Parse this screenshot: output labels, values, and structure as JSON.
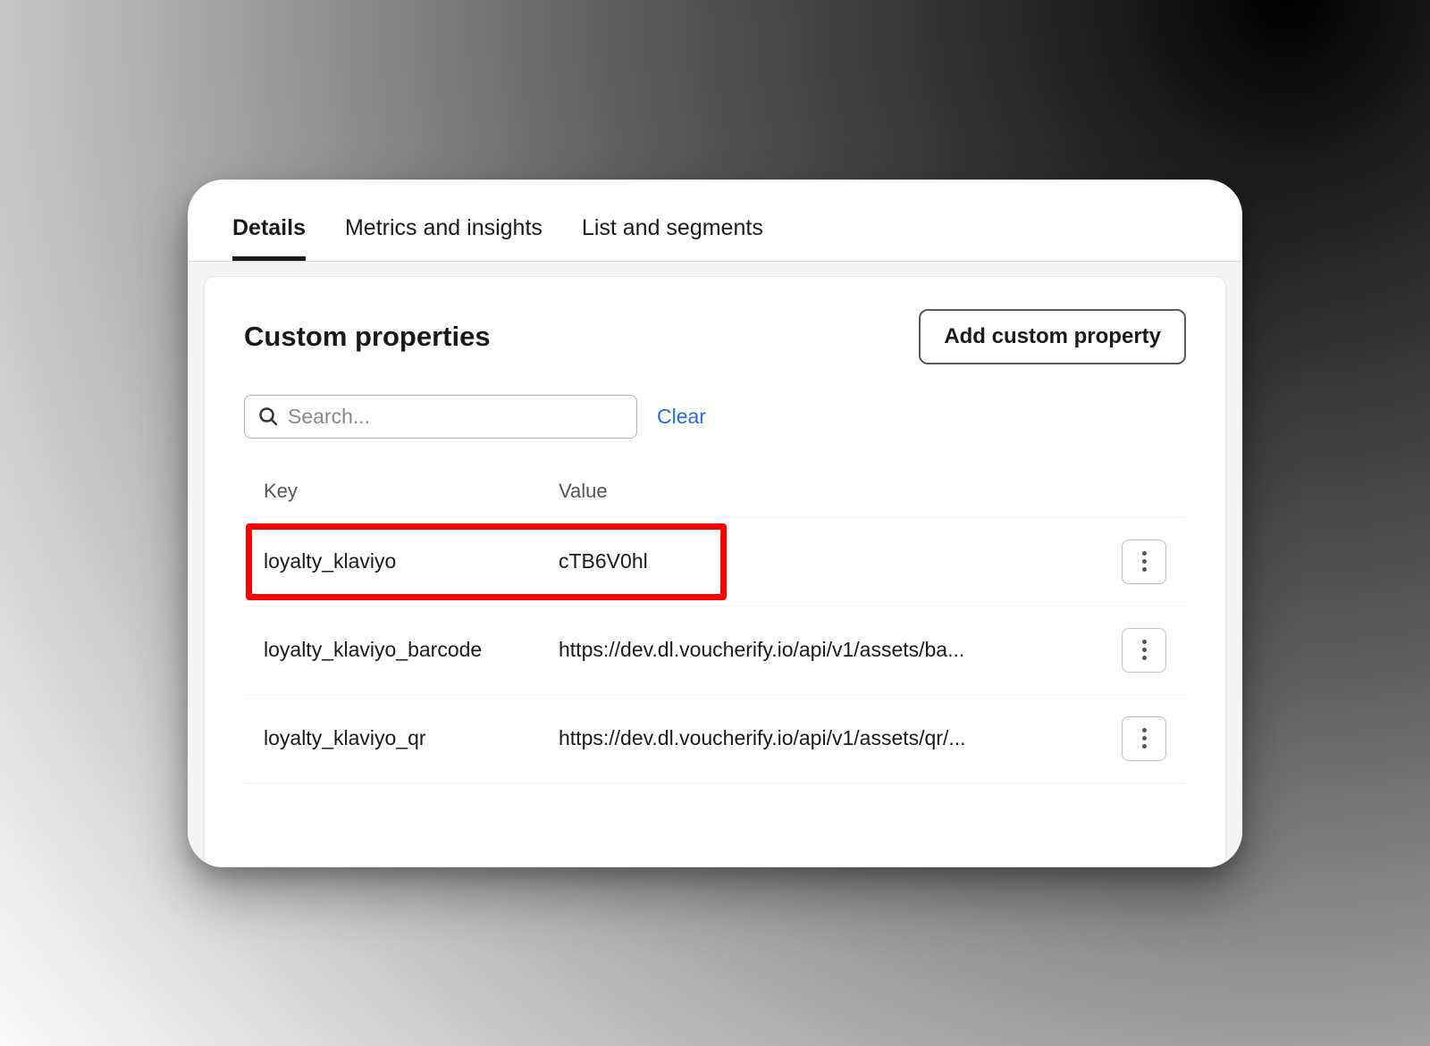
{
  "tabs": [
    {
      "label": "Details",
      "active": true
    },
    {
      "label": "Metrics and insights",
      "active": false
    },
    {
      "label": "List and segments",
      "active": false
    }
  ],
  "panel": {
    "title": "Custom properties",
    "add_button": "Add custom property",
    "search_placeholder": "Search...",
    "clear_label": "Clear",
    "columns": {
      "key": "Key",
      "value": "Value"
    },
    "rows": [
      {
        "key": "loyalty_klaviyo",
        "value": "cTB6V0hl",
        "highlighted": true
      },
      {
        "key": "loyalty_klaviyo_barcode",
        "value": "https://dev.dl.voucherify.io/api/v1/assets/ba...",
        "highlighted": false
      },
      {
        "key": "loyalty_klaviyo_qr",
        "value": "https://dev.dl.voucherify.io/api/v1/assets/qr/...",
        "highlighted": false
      }
    ]
  }
}
